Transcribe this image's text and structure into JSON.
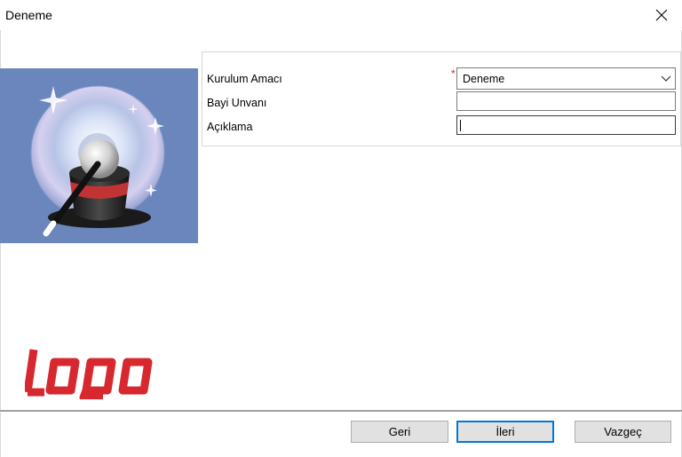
{
  "window": {
    "title": "Deneme",
    "close_icon": "close-icon"
  },
  "form": {
    "kurulum_amaci": {
      "label": "Kurulum Amacı",
      "required_mark": "*",
      "value": "Deneme",
      "dropdown_icon": "chevron-down-icon"
    },
    "bayi_unvani": {
      "label": "Bayi Unvanı",
      "value": ""
    },
    "aciklama": {
      "label": "Açıklama",
      "value": ""
    }
  },
  "branding": {
    "logo_text": "logo",
    "logo_color": "#d7282f",
    "image": "wizard-disc-magic-hat-image"
  },
  "buttons": {
    "back": "Geri",
    "next": "İleri",
    "cancel": "Vazgeç"
  }
}
